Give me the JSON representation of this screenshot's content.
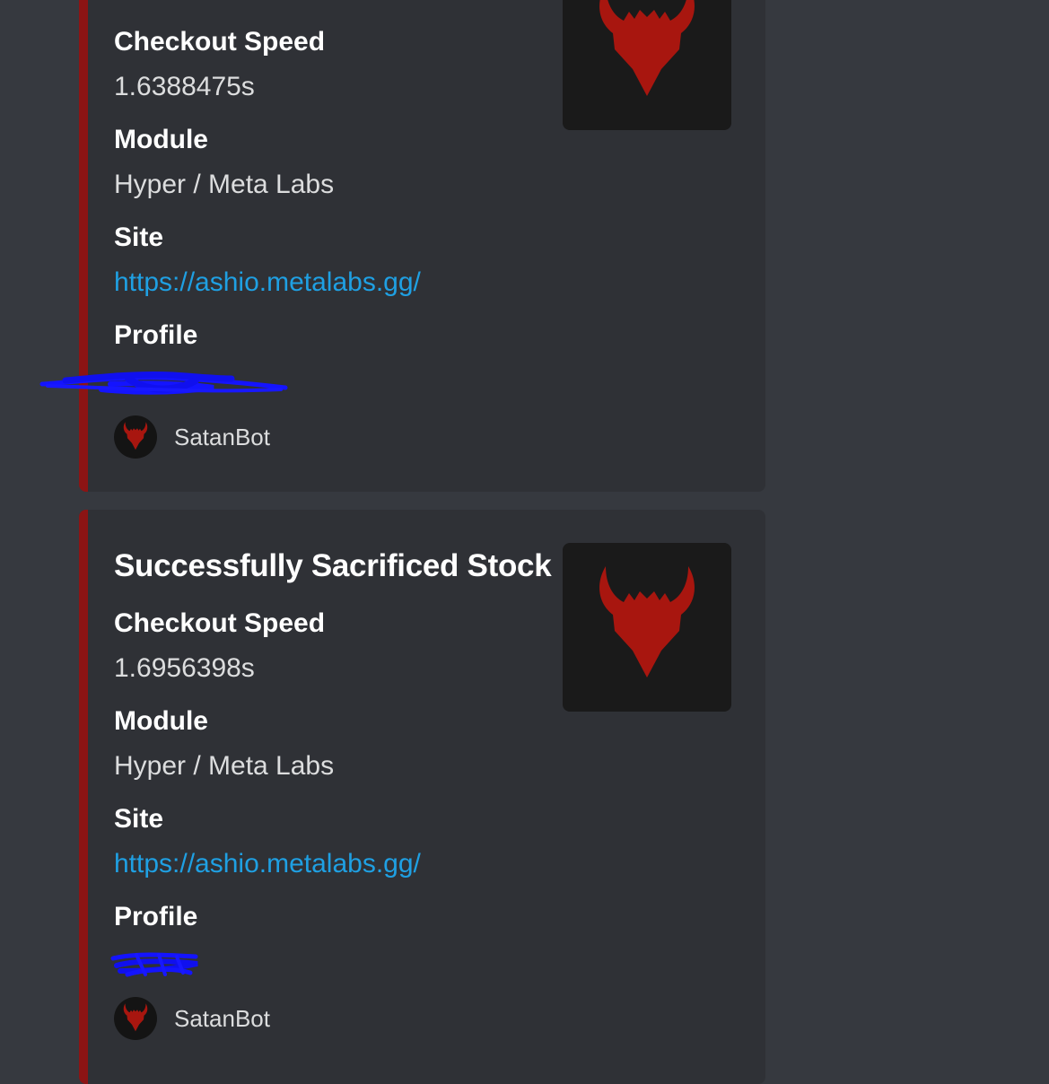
{
  "brand_colors": {
    "accent_bar": "#8c1414",
    "devil_red": "#a8160f",
    "link": "#1fa0e3"
  },
  "embeds": [
    {
      "title": "",
      "thumbnail_icon": "devil-head-icon",
      "fields": [
        {
          "name": "Checkout Speed",
          "value": "1.6388475s"
        },
        {
          "name": "Module",
          "value": "Hyper / Meta Labs"
        },
        {
          "name": "Site",
          "value": "https://ashio.metalabs.gg/"
        },
        {
          "name": "Profile",
          "value": ""
        }
      ],
      "footer": {
        "bot_name": "SatanBot",
        "avatar_icon": "devil-head-icon"
      }
    },
    {
      "title": "Successfully Sacrificed Stock",
      "thumbnail_icon": "devil-head-icon",
      "fields": [
        {
          "name": "Checkout Speed",
          "value": "1.6956398s"
        },
        {
          "name": "Module",
          "value": "Hyper / Meta Labs"
        },
        {
          "name": "Site",
          "value": "https://ashio.metalabs.gg/"
        },
        {
          "name": "Profile",
          "value": ""
        }
      ],
      "footer": {
        "bot_name": "SatanBot",
        "avatar_icon": "devil-head-icon"
      }
    }
  ]
}
